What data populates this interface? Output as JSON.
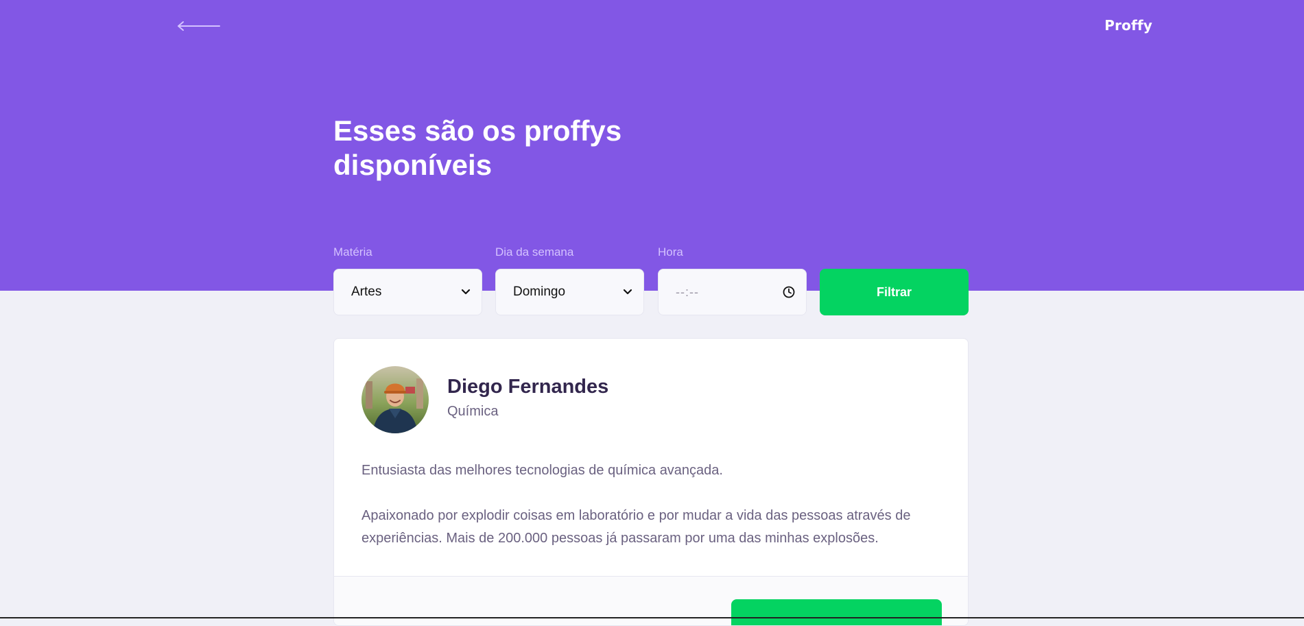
{
  "header": {
    "back_icon": "arrow-left-icon",
    "logo_text": "Proffy"
  },
  "page": {
    "title": "Esses são os proffys disponíveis"
  },
  "filters": {
    "subject": {
      "label": "Matéria",
      "value": "Artes"
    },
    "weekday": {
      "label": "Dia da semana",
      "value": "Domingo"
    },
    "time": {
      "label": "Hora",
      "placeholder": "--:--"
    },
    "submit_label": "Filtrar"
  },
  "teachers": [
    {
      "name": "Diego Fernandes",
      "subject": "Química",
      "bio_1": "Entusiasta das melhores tecnologias de química avançada.",
      "bio_2": "Apaixonado por explodir coisas em laboratório e por mudar a vida das pessoas através de experiências. Mais de 200.000 pessoas já passaram por uma das minhas explosões."
    }
  ],
  "colors": {
    "primary": "#8257e5",
    "secondary": "#04d361",
    "background": "#f0f0f7",
    "title_dark": "#32264d",
    "text_muted": "#6a6180"
  }
}
